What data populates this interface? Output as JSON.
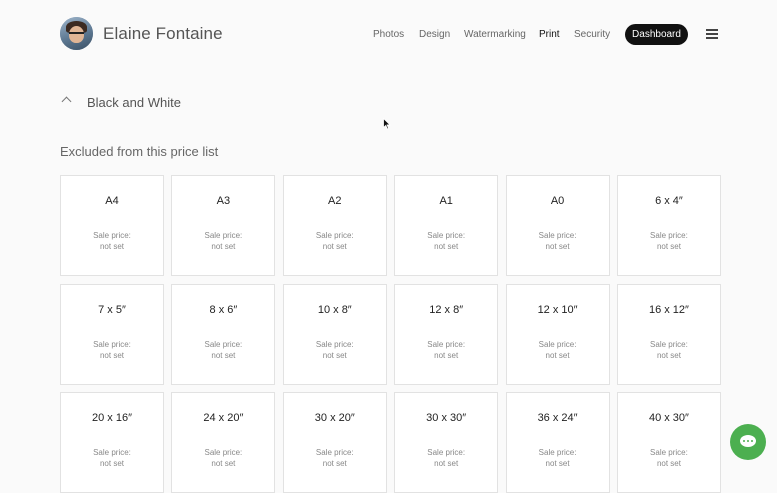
{
  "header": {
    "site_name": "Elaine Fontaine",
    "nav": [
      {
        "label": "Photos"
      },
      {
        "label": "Design"
      },
      {
        "label": "Watermarking"
      },
      {
        "label": "Print"
      },
      {
        "label": "Security"
      }
    ],
    "active_nav": "Print",
    "dashboard_label": "Dashboard",
    "menu_icon": "hamburger-menu-icon"
  },
  "section": {
    "title": "Black and White",
    "toggle_icon": "chevron-up-icon"
  },
  "excluded": {
    "title": "Excluded from this price list",
    "sale_label": "Sale price:",
    "sale_value": "not set",
    "items": [
      {
        "size": "A4"
      },
      {
        "size": "A3"
      },
      {
        "size": "A2"
      },
      {
        "size": "A1"
      },
      {
        "size": "A0"
      },
      {
        "size": "6 x 4″"
      },
      {
        "size": "7 x 5″"
      },
      {
        "size": "8 x 6″"
      },
      {
        "size": "10 x 8″"
      },
      {
        "size": "12 x 8″"
      },
      {
        "size": "12 x 10″"
      },
      {
        "size": "16 x 12″"
      },
      {
        "size": "20 x 16″"
      },
      {
        "size": "24 x 20″"
      },
      {
        "size": "30 x 20″"
      },
      {
        "size": "30 x 30″"
      },
      {
        "size": "36 x 24″"
      },
      {
        "size": "40 x 30″"
      }
    ]
  },
  "chat": {
    "icon": "chat-bubble-icon",
    "color": "#4caf50"
  }
}
